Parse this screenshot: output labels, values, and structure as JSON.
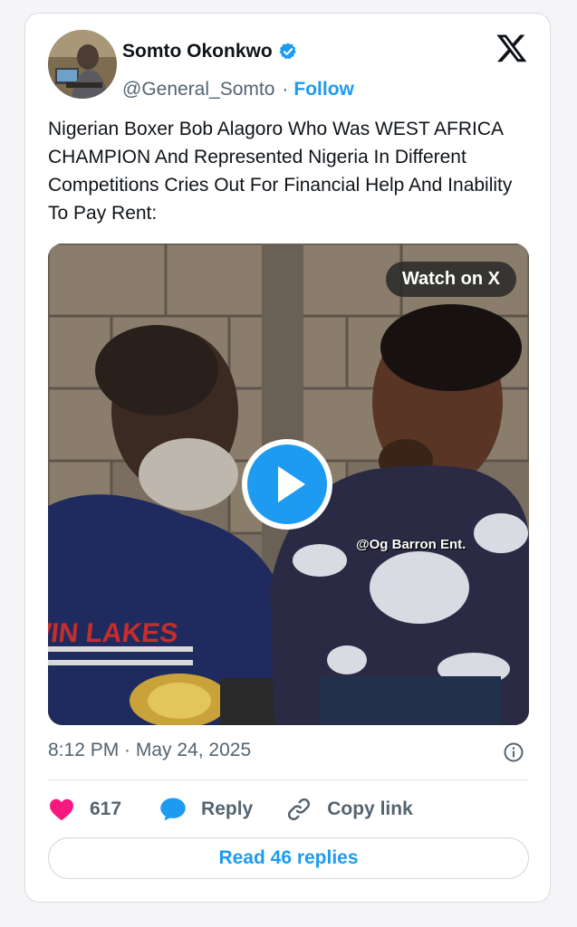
{
  "author": {
    "name": "Somto Okonkwo",
    "handle": "@General_Somto",
    "separator": "·",
    "follow_label": "Follow"
  },
  "tweet": {
    "text": "Nigerian Boxer Bob Alagoro Who Was WEST AFRICA CHAMPION And Represented Nigeria In Different Competitions Cries Out For Financial Help And Inability To Pay Rent:",
    "timestamp": "8:12 PM · May 24, 2025"
  },
  "media": {
    "watch_label": "Watch on X",
    "watermark": "@Og Barron Ent.",
    "shirt_text": "TWIN LAKES"
  },
  "actions": {
    "likes": "617",
    "reply_label": "Reply",
    "copy_label": "Copy link"
  },
  "read_replies_label": "Read 46 replies",
  "colors": {
    "accent": "#1d9bf0",
    "like": "#f91880",
    "text": "#0f1419",
    "muted": "#536471"
  },
  "icons": [
    "verified-badge-icon",
    "x-logo-icon",
    "play-icon",
    "info-icon",
    "heart-icon",
    "reply-bubble-icon",
    "link-icon"
  ]
}
